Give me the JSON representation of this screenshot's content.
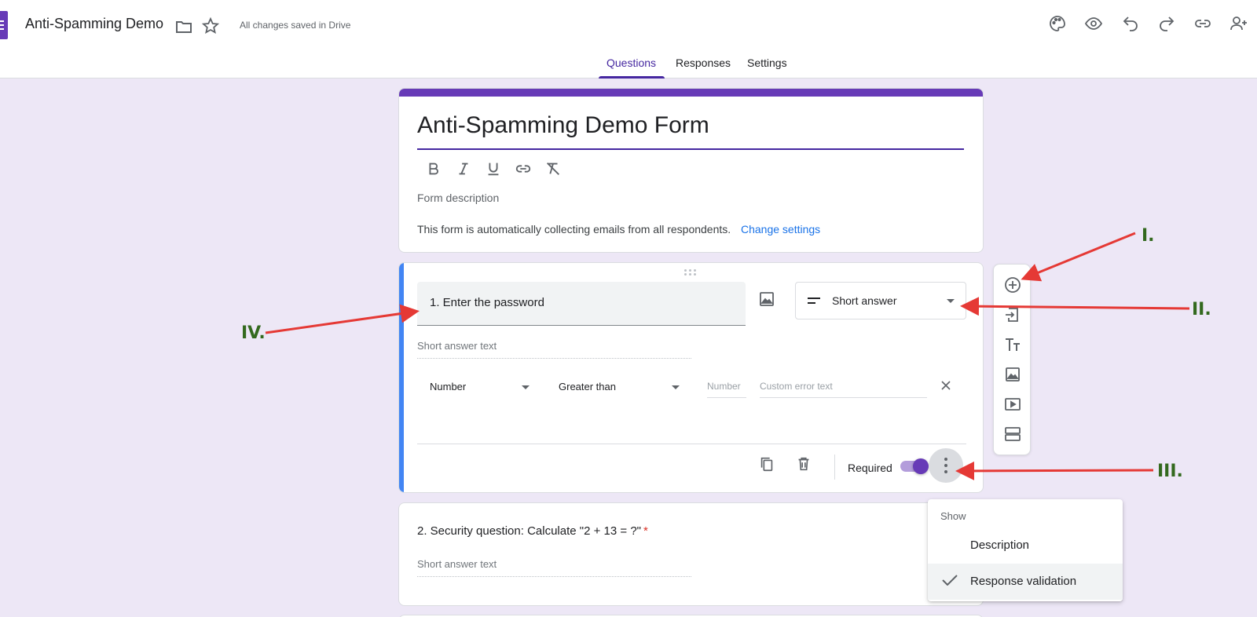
{
  "header": {
    "doc_title": "Anti-Spamming Demo",
    "save_status": "All changes saved in Drive",
    "tabs": [
      {
        "label": "Questions",
        "active": true
      },
      {
        "label": "Responses",
        "active": false
      },
      {
        "label": "Settings",
        "active": false
      }
    ]
  },
  "form": {
    "title": "Anti-Spamming Demo Form",
    "description_placeholder": "Form description",
    "email_notice": "This form is automatically collecting emails from all respondents.",
    "change_settings_link": "Change settings"
  },
  "question1": {
    "title": "1. Enter the password",
    "type": "Short answer",
    "answer_hint": "Short answer text",
    "validation": {
      "field": "Number",
      "condition": "Greater than",
      "value_placeholder": "Number",
      "error_placeholder": "Custom error text"
    },
    "required_label": "Required",
    "required": true
  },
  "question2": {
    "title": "2. Security question: Calculate \"2 + 13 = ?\"",
    "required_mark": "*",
    "answer_hint": "Short answer text"
  },
  "menu": {
    "header": "Show",
    "items": [
      {
        "label": "Description",
        "checked": false
      },
      {
        "label": "Response validation",
        "checked": true
      }
    ]
  },
  "annotations": {
    "labels": [
      "I.",
      "II.",
      "III.",
      "IV."
    ],
    "arrow_color": "#e53935",
    "label_color": "#33691e"
  },
  "colors": {
    "accent": "#673ab7",
    "tab_active": "#4527a0",
    "focus_bar": "#4285f4",
    "link": "#1a73e8",
    "background": "#ede7f6"
  }
}
